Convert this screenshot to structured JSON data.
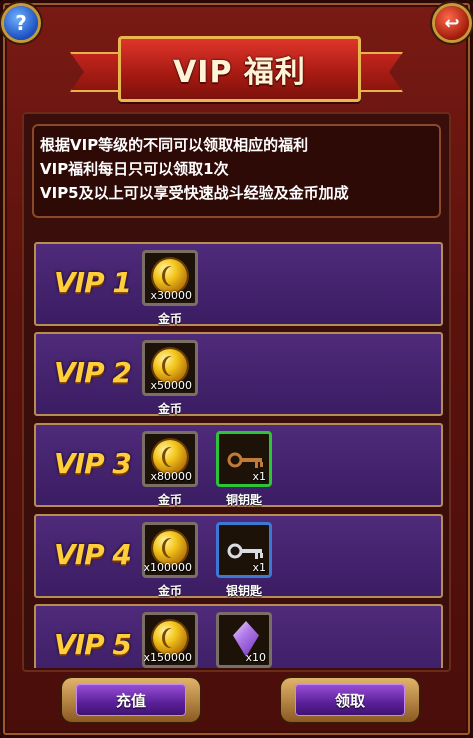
{
  "header": {
    "title": "VIP 福利",
    "help_icon": "question-mark-icon",
    "help_glyph": "?",
    "back_icon": "return-arrow-icon",
    "back_glyph": "↩"
  },
  "description": {
    "lines": [
      "根据VIP等级的不同可以领取相应的福利",
      "VIP福利每日只可以领取1次",
      "VIP5及以上可以享受快速战斗经验及金币加成"
    ]
  },
  "tiers": [
    {
      "label": "VIP 1",
      "rewards": [
        {
          "name": "金币",
          "qty": "x30000",
          "icon": "gold-coin-icon"
        }
      ]
    },
    {
      "label": "VIP 2",
      "rewards": [
        {
          "name": "金币",
          "qty": "x50000",
          "icon": "gold-coin-icon"
        }
      ]
    },
    {
      "label": "VIP 3",
      "rewards": [
        {
          "name": "金币",
          "qty": "x80000",
          "icon": "gold-coin-icon"
        },
        {
          "name": "铜钥匙",
          "qty": "x1",
          "icon": "copper-key-icon"
        }
      ]
    },
    {
      "label": "VIP 4",
      "rewards": [
        {
          "name": "金币",
          "qty": "x100000",
          "icon": "gold-coin-icon"
        },
        {
          "name": "银钥匙",
          "qty": "x1",
          "icon": "silver-key-icon"
        }
      ]
    },
    {
      "label": "VIP 5",
      "rewards": [
        {
          "name": "",
          "qty": "x150000",
          "icon": "gold-coin-icon"
        },
        {
          "name": "",
          "qty": "x10",
          "icon": "purple-gem-icon"
        }
      ]
    }
  ],
  "footer": {
    "recharge_label": "充值",
    "claim_label": "领取"
  },
  "colors": {
    "vip_label": "#ffce3a",
    "row_bg": "#3b1d63",
    "button": "#5a1f98",
    "copper_key_border": "#2ec43a",
    "silver_key_border": "#3d79d4"
  }
}
